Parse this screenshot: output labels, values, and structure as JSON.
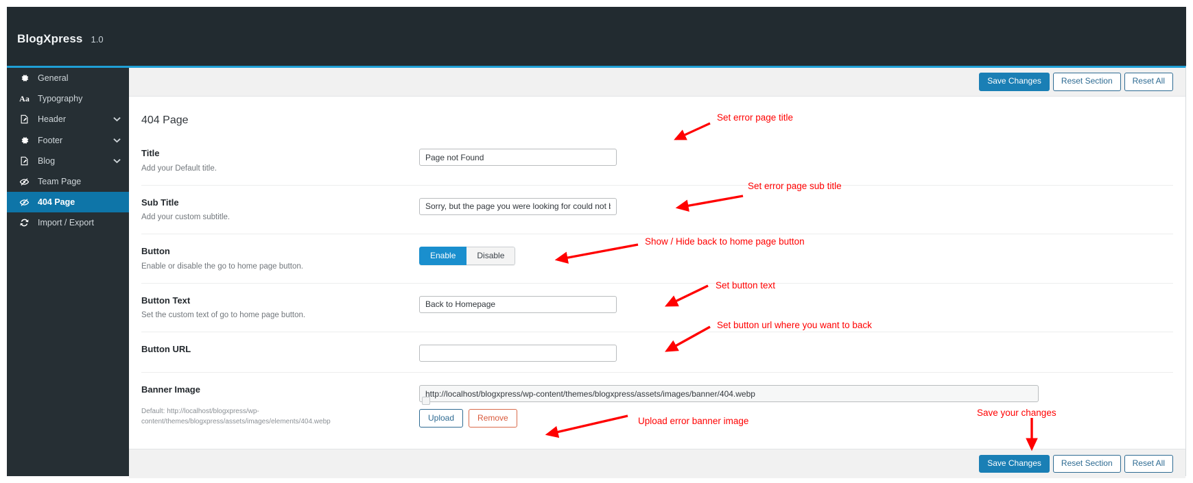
{
  "header": {
    "brand": "BlogXpress",
    "version": "1.0"
  },
  "sidebar": {
    "items": [
      {
        "label": "General",
        "icon": "gear-icon",
        "caret": false,
        "active": false
      },
      {
        "label": "Typography",
        "icon": "typography-icon",
        "caret": false,
        "active": false
      },
      {
        "label": "Header",
        "icon": "pencil-page-icon",
        "caret": true,
        "active": false
      },
      {
        "label": "Footer",
        "icon": "gear-icon",
        "caret": true,
        "active": false
      },
      {
        "label": "Blog",
        "icon": "pencil-page-icon",
        "caret": true,
        "active": false
      },
      {
        "label": "Team Page",
        "icon": "eye-slash-icon",
        "caret": false,
        "active": false
      },
      {
        "label": "404 Page",
        "icon": "eye-slash-icon",
        "caret": false,
        "active": true
      },
      {
        "label": "Import / Export",
        "icon": "refresh-icon",
        "caret": false,
        "active": false
      }
    ]
  },
  "toolbar": {
    "save_label": "Save Changes",
    "reset_section_label": "Reset Section",
    "reset_all_label": "Reset All"
  },
  "main": {
    "section_title": "404 Page",
    "fields": {
      "title": {
        "label": "Title",
        "desc": "Add your Default title.",
        "value": "Page not Found"
      },
      "subtitle": {
        "label": "Sub Title",
        "desc": "Add your custom subtitle.",
        "value": "Sorry, but the page you were looking for could not be"
      },
      "button": {
        "label": "Button",
        "desc": "Enable or disable the go to home page button.",
        "enable_label": "Enable",
        "disable_label": "Disable",
        "selected": "Enable"
      },
      "button_text": {
        "label": "Button Text",
        "desc": "Set the custom text of go to home page button.",
        "value": "Back to Homepage"
      },
      "button_url": {
        "label": "Button URL",
        "desc": "",
        "value": ""
      },
      "banner_image": {
        "label": "Banner Image",
        "default_note": "Default: http://localhost/blogxpress/wp-content/themes/blogxpress/assets/images/elements/404.webp",
        "value": "http://localhost/blogxpress/wp-content/themes/blogxpress/assets/images/banner/404.webp",
        "upload_label": "Upload",
        "remove_label": "Remove"
      }
    }
  },
  "annotations": {
    "color": "#ff0000",
    "items": [
      {
        "text": "Set error page title"
      },
      {
        "text": "Set error page sub title"
      },
      {
        "text": "Show / Hide back to home page button"
      },
      {
        "text": "Set button text"
      },
      {
        "text": "Set button url where you want to back"
      },
      {
        "text": "Upload error banner image"
      },
      {
        "text": "Save your changes"
      }
    ]
  },
  "colors": {
    "accent": "#1fa0d6",
    "sidebar_bg": "#262f34",
    "sidebar_active": "#0e75a8",
    "header_bg": "#222b30",
    "primary_button": "#1a7fb5",
    "annotation": "#ff0000"
  }
}
